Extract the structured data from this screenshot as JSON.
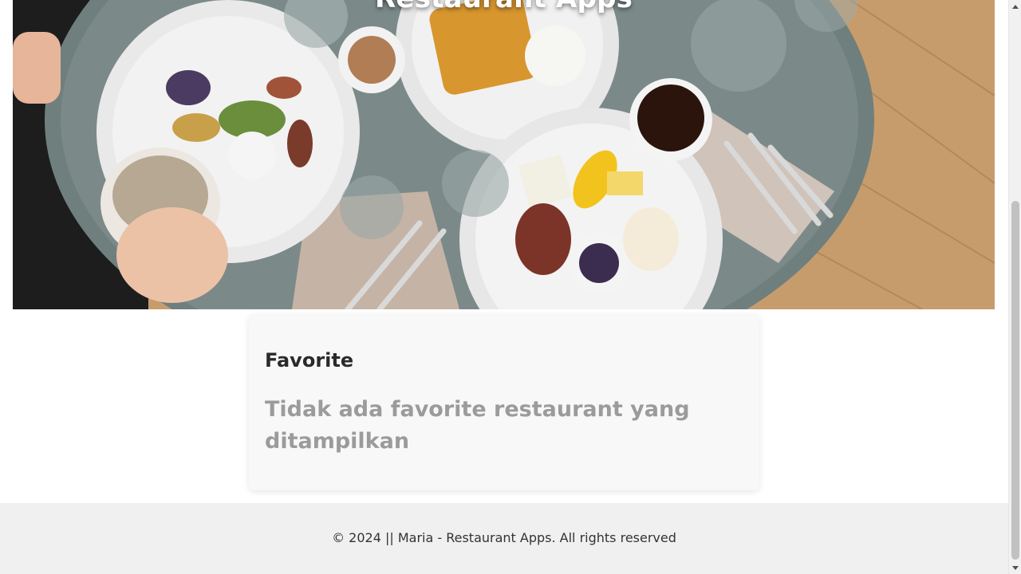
{
  "hero": {
    "title": "Restaurant Apps",
    "image": "breakfast-table-photo"
  },
  "favorite": {
    "title": "Favorite",
    "empty_message": "Tidak ada favorite restaurant yang ditampilkan"
  },
  "footer": {
    "text": "© 2024 || Maria - Restaurant Apps. All rights reserved"
  },
  "scrollbar": {
    "up_icon": "arrow-up-icon",
    "down_icon": "arrow-down-icon"
  }
}
